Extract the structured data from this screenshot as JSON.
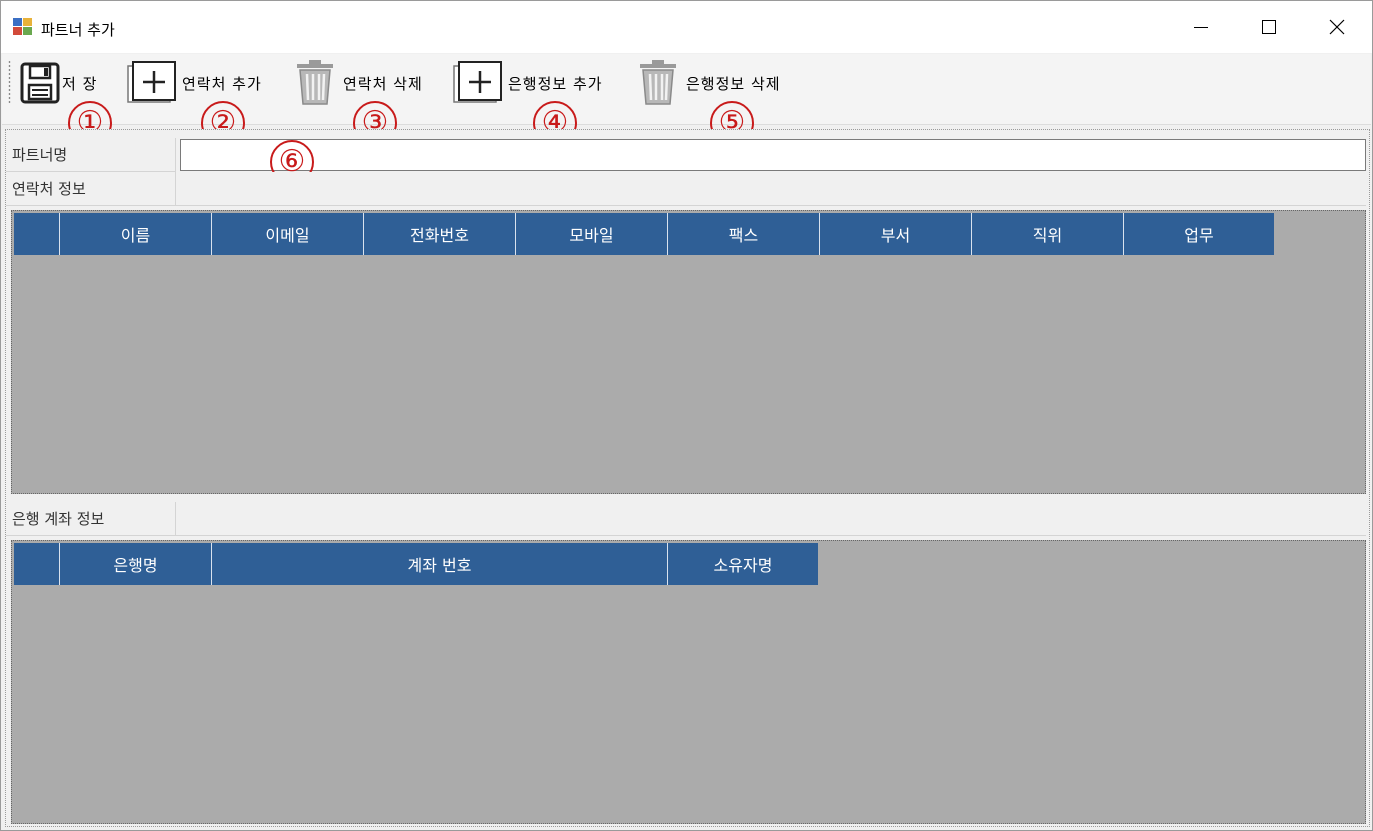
{
  "window": {
    "title": "파트너 추가",
    "controls": {
      "minimize": "minimize-icon",
      "maximize": "maximize-icon",
      "close": "close-icon"
    }
  },
  "toolbar": {
    "buttons": [
      {
        "label": "저 장",
        "icon": "save-icon",
        "marker": "①"
      },
      {
        "label": "연락처 추가",
        "icon": "add-icon",
        "marker": "②"
      },
      {
        "label": "연락처 삭제",
        "icon": "trash-icon",
        "marker": "③"
      },
      {
        "label": "은행정보 추가",
        "icon": "add-icon",
        "marker": "④"
      },
      {
        "label": "은행정보 삭제",
        "icon": "trash-icon",
        "marker": "⑤"
      }
    ]
  },
  "form": {
    "partner_name_label": "파트너명",
    "partner_name_value": "",
    "partner_name_marker": "⑥",
    "contact_section_label": "연락처 정보",
    "contact_columns": [
      "",
      "이름",
      "이메일",
      "전화번호",
      "모바일",
      "팩스",
      "부서",
      "직위",
      "업무"
    ],
    "bank_section_label": "은행 계좌 정보",
    "bank_columns": [
      "",
      "은행명",
      "계좌 번호",
      "소유자명"
    ]
  },
  "colors": {
    "grid_header": "#2f5f96",
    "grid_background": "#ababab",
    "marker": "#c81a1a"
  }
}
